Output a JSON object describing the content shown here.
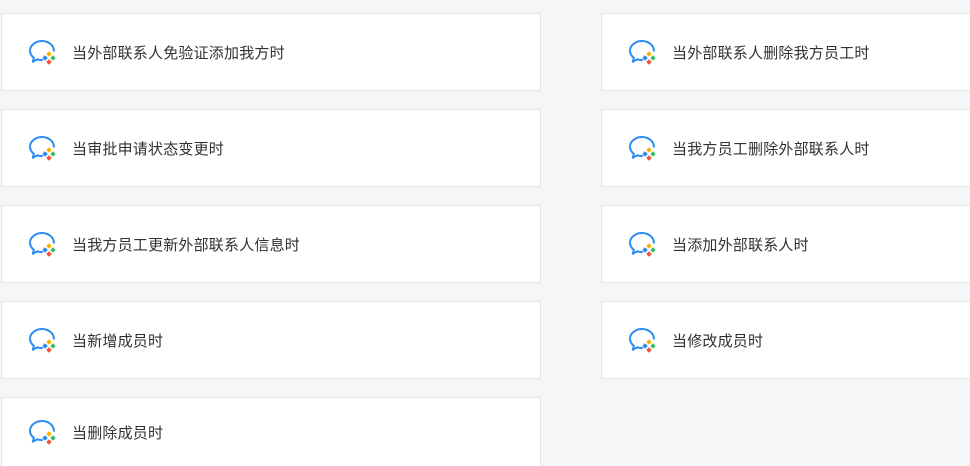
{
  "triggers": [
    {
      "label": "当外部联系人免验证添加我方时",
      "icon": "wecom-chat-icon"
    },
    {
      "label": "当外部联系人删除我方员工时",
      "icon": "wecom-chat-icon"
    },
    {
      "label": "当审批申请状态变更时",
      "icon": "wecom-chat-icon"
    },
    {
      "label": "当我方员工删除外部联系人时",
      "icon": "wecom-chat-icon"
    },
    {
      "label": "当我方员工更新外部联系人信息时",
      "icon": "wecom-chat-icon"
    },
    {
      "label": "当添加外部联系人时",
      "icon": "wecom-chat-icon"
    },
    {
      "label": "当新增成员时",
      "icon": "wecom-chat-icon"
    },
    {
      "label": "当修改成员时",
      "icon": "wecom-chat-icon"
    },
    {
      "label": "当删除成员时",
      "icon": "wecom-chat-icon"
    }
  ],
  "colors": {
    "icon_outline": "#2a8cf0",
    "icon_accent_yellow": "#f7b500",
    "icon_accent_green": "#3dbf6e",
    "icon_accent_red": "#f0553e",
    "icon_accent_blue": "#2a8cf0",
    "text": "#303133",
    "border": "#e3e5e8",
    "background": "#f5f6f8"
  }
}
